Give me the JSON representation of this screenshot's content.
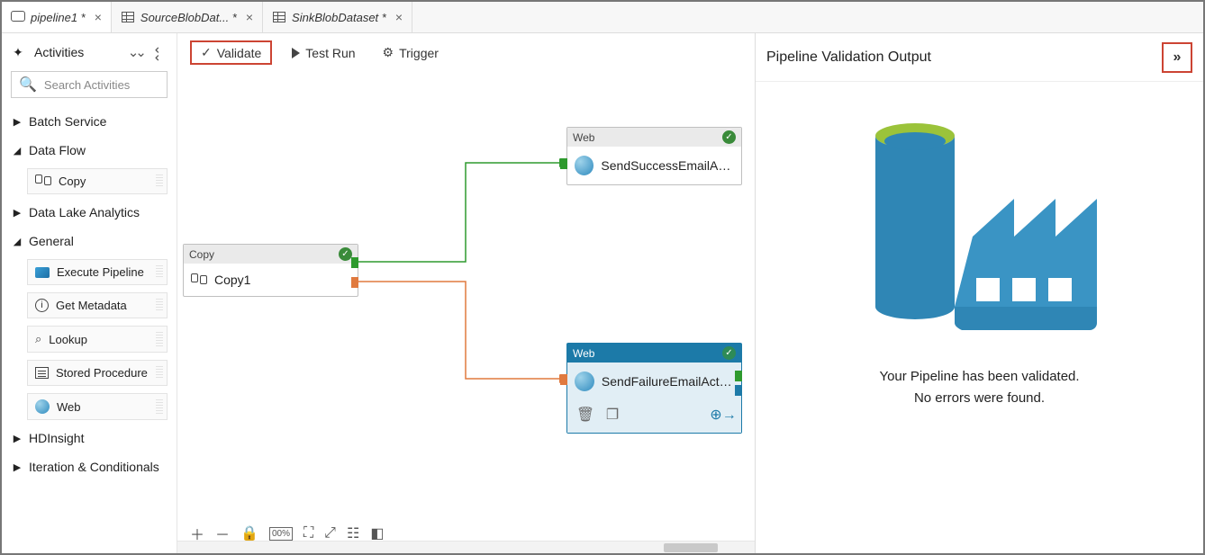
{
  "tabs": [
    {
      "title": "pipeline1 *",
      "italic": true,
      "icon": "pipeline-icon"
    },
    {
      "title": "SourceBlobDat... *",
      "italic": true,
      "icon": "dataset-icon"
    },
    {
      "title": "SinkBlobDataset *",
      "italic": true,
      "icon": "dataset-icon"
    }
  ],
  "sidebar": {
    "heading": "Activities",
    "search_placeholder": "Search Activities",
    "groups": [
      {
        "label": "Batch Service",
        "expanded": false,
        "items": []
      },
      {
        "label": "Data Flow",
        "expanded": true,
        "items": [
          {
            "label": "Copy",
            "icon": "copy-icon"
          }
        ]
      },
      {
        "label": "Data Lake Analytics",
        "expanded": false,
        "items": []
      },
      {
        "label": "General",
        "expanded": true,
        "items": [
          {
            "label": "Execute Pipeline",
            "icon": "execute-pipeline-icon"
          },
          {
            "label": "Get Metadata",
            "icon": "info-icon"
          },
          {
            "label": "Lookup",
            "icon": "lookup-icon"
          },
          {
            "label": "Stored Procedure",
            "icon": "stored-proc-icon"
          },
          {
            "label": "Web",
            "icon": "web-icon"
          }
        ]
      },
      {
        "label": "HDInsight",
        "expanded": false,
        "items": []
      },
      {
        "label": "Iteration & Conditionals",
        "expanded": false,
        "items": []
      }
    ]
  },
  "toolbar": {
    "validate": "Validate",
    "testrun": "Test Run",
    "trigger": "Trigger"
  },
  "nodes": {
    "copy": {
      "type": "Copy",
      "name": "Copy1"
    },
    "success": {
      "type": "Web",
      "name": "SendSuccessEmailActi.."
    },
    "failure": {
      "type": "Web",
      "name": "SendFailureEmailActiv.."
    }
  },
  "validation": {
    "title": "Pipeline Validation Output",
    "line1": "Your Pipeline has been validated.",
    "line2": "No errors were found."
  }
}
